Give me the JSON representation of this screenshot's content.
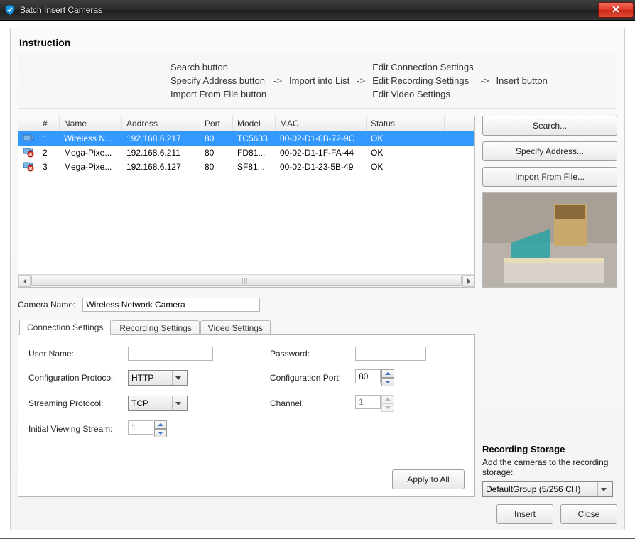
{
  "window": {
    "title": "Batch Insert Cameras"
  },
  "instruction": {
    "heading": "Instruction",
    "col1": [
      "Search button",
      "Specify Address button",
      "Import From File button"
    ],
    "mid": "Import into List",
    "col2": [
      "Edit Connection Settings",
      "Edit Recording Settings",
      "Edit Video Settings"
    ],
    "tail": "Insert button",
    "arrow": "->"
  },
  "list": {
    "headers": {
      "num": "#",
      "name": "Name",
      "address": "Address",
      "port": "Port",
      "model": "Model",
      "mac": "MAC",
      "status": "Status"
    },
    "rows": [
      {
        "num": "1",
        "name": "Wireless N...",
        "address": "192.168.6.217",
        "port": "80",
        "model": "TC5633",
        "mac": "00-02-D1-0B-72-9C",
        "status": "OK",
        "selected": true,
        "error": false
      },
      {
        "num": "2",
        "name": "Mega-Pixe...",
        "address": "192.168.6.211",
        "port": "80",
        "model": "FD81...",
        "mac": "00-02-D1-1F-FA-44",
        "status": "OK",
        "selected": false,
        "error": true
      },
      {
        "num": "3",
        "name": "Mega-Pixe...",
        "address": "192.168.6.127",
        "port": "80",
        "model": "SF81...",
        "mac": "00-02-D1-23-5B-49",
        "status": "OK",
        "selected": false,
        "error": true
      }
    ]
  },
  "side": {
    "search": "Search...",
    "specify": "Specify Address...",
    "import": "Import From File..."
  },
  "camera_name": {
    "label": "Camera Name:",
    "value": "Wireless Network Camera"
  },
  "tabs": {
    "connection": "Connection Settings",
    "recording": "Recording Settings",
    "video": "Video Settings"
  },
  "conn": {
    "user_label": "User Name:",
    "user_value": "",
    "pass_label": "Password:",
    "pass_value": "",
    "cfgproto_label": "Configuration Protocol:",
    "cfgproto_value": "HTTP",
    "cfgport_label": "Configuration Port:",
    "cfgport_value": "80",
    "streamproto_label": "Streaming Protocol:",
    "streamproto_value": "TCP",
    "channel_label": "Channel:",
    "channel_value": "1",
    "initview_label": "Initial Viewing Stream:",
    "initview_value": "1",
    "apply": "Apply to All"
  },
  "storage": {
    "heading": "Recording Storage",
    "desc": "Add the cameras to the recording storage:",
    "combo": "DefaultGroup (5/256 CH)"
  },
  "footer": {
    "insert": "Insert",
    "close": "Close"
  }
}
